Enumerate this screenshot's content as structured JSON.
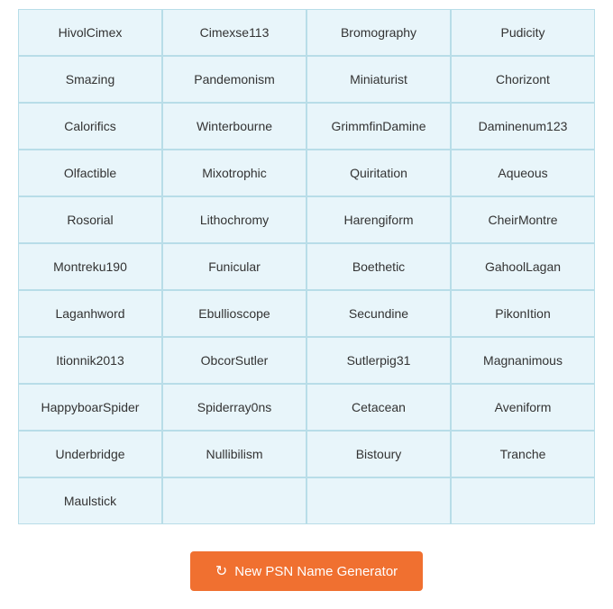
{
  "grid": {
    "rows": [
      [
        "HivolCimex",
        "Cimexse113",
        "Bromography",
        "Pudicity"
      ],
      [
        "Smazing",
        "Pandemonism",
        "Miniaturist",
        "Chorizont"
      ],
      [
        "Calorifics",
        "Winterbourne",
        "GrimmfinDamine",
        "Daminenum123"
      ],
      [
        "Olfactible",
        "Mixotrophic",
        "Quiritation",
        "Aqueous"
      ],
      [
        "Rosorial",
        "Lithochromy",
        "Harengiform",
        "CheirMontre"
      ],
      [
        "Montreku190",
        "Funicular",
        "Boethetic",
        "GahoolLagan"
      ],
      [
        "Laganhword",
        "Ebullioscope",
        "Secundine",
        "PikonItion"
      ],
      [
        "Itionnik2013",
        "ObcorSutler",
        "Sutlerpig31",
        "Magnanimous"
      ],
      [
        "HappyboarSpider",
        "Spiderray0ns",
        "Cetacean",
        "Aveniform"
      ],
      [
        "Underbridge",
        "Nullibilism",
        "Bistoury",
        "Tranche"
      ],
      [
        "Maulstick",
        "",
        "",
        ""
      ]
    ]
  },
  "button": {
    "label": "New PSN Name Generator",
    "icon": "↻"
  }
}
